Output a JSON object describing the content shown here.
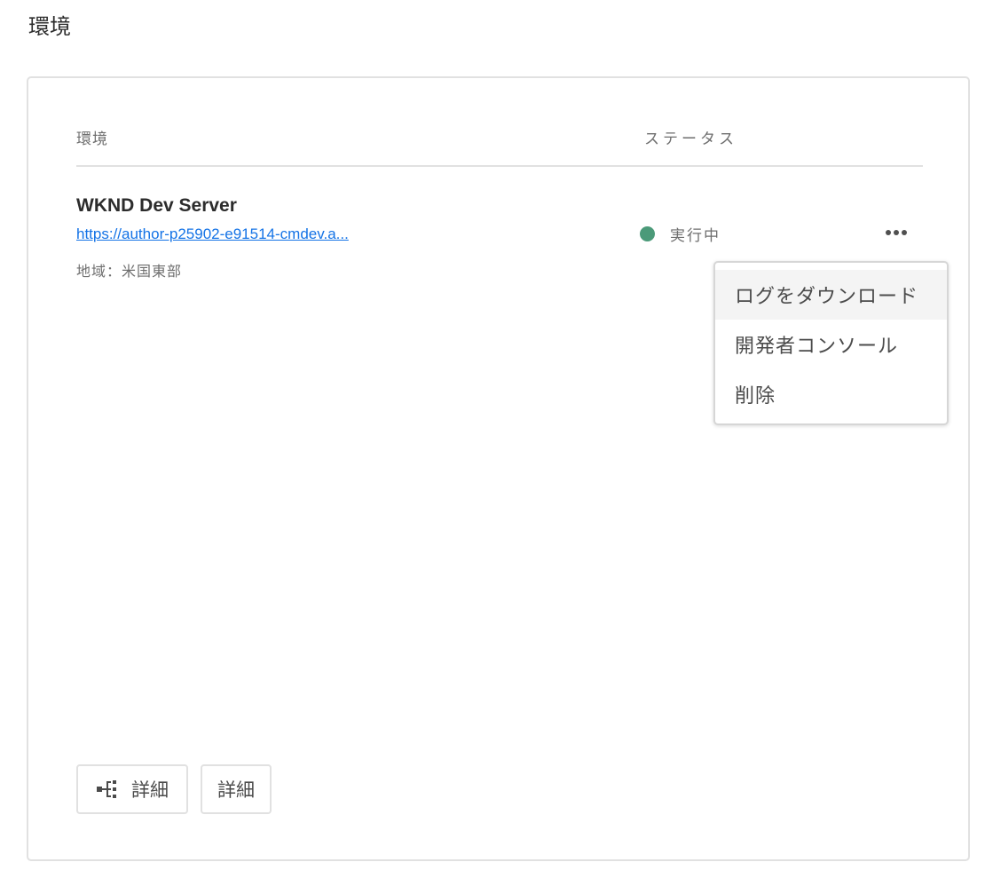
{
  "page": {
    "title": "環境"
  },
  "table": {
    "headers": {
      "environment": "環境",
      "status": "ステータス"
    }
  },
  "environment": {
    "name": "WKND Dev Server",
    "url_text": "https://author-p25902-e91514-cmdev.a...",
    "region": "地域：米国東部",
    "status": "実行中",
    "status_color": "#4b9a79"
  },
  "actions_menu": {
    "items": [
      {
        "label": "ログをダウンロード"
      },
      {
        "label": "開発者コンソール"
      },
      {
        "label": "削除"
      }
    ]
  },
  "buttons": {
    "details_with_icon": {
      "label": "詳細",
      "icon": "tree-hierarchy-icon"
    },
    "details": {
      "label": "詳細"
    }
  },
  "colors": {
    "link": "#1473e6",
    "border": "#e1e1e1"
  }
}
